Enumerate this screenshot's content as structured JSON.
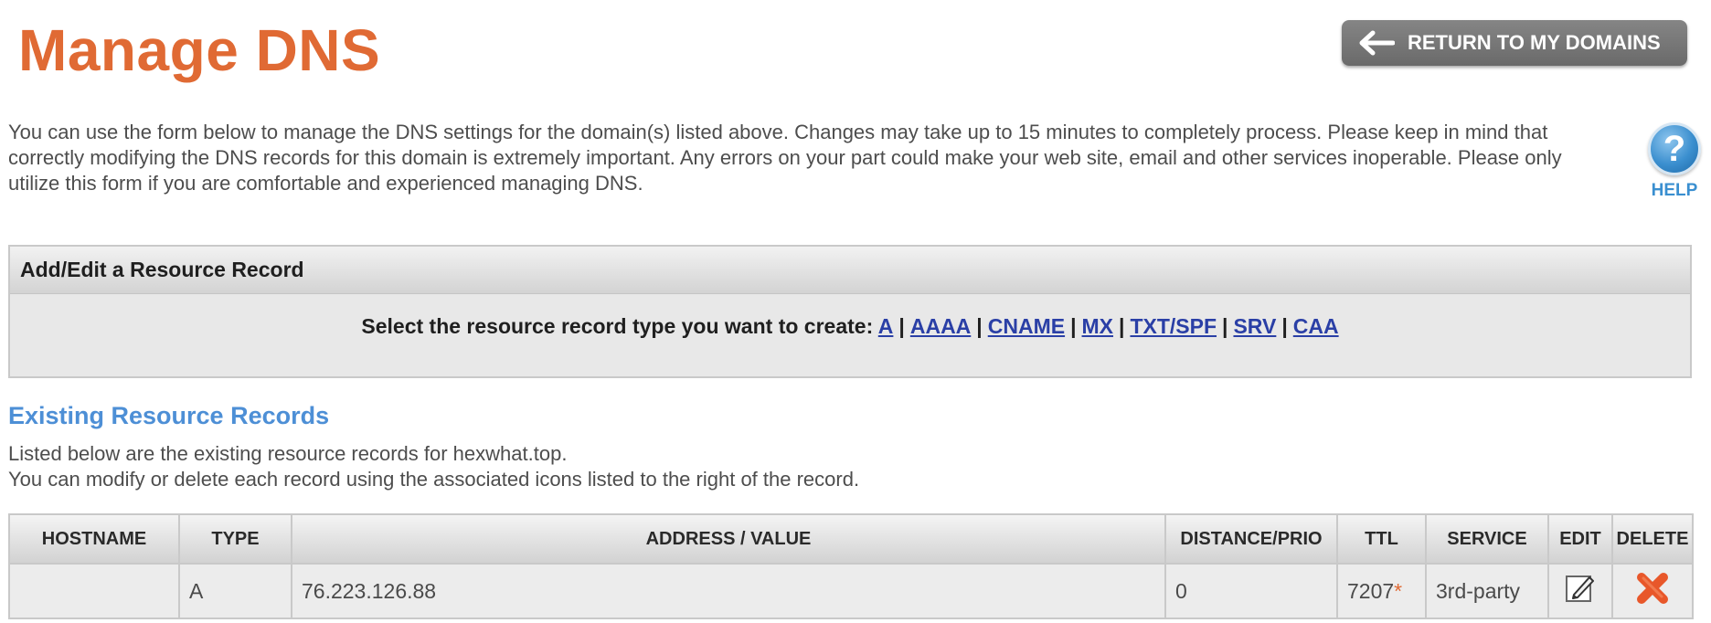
{
  "page": {
    "title": "Manage DNS",
    "return_button_label": "RETURN TO MY DOMAINS",
    "intro_text": "You can use the form below to manage the DNS settings for the domain(s) listed above. Changes may take up to 15 minutes to completely process. Please keep in mind that correctly modifying the DNS records for this domain is extremely important. Any errors on your part could make your web site, email and other services inoperable. Please only utilize this form if you are comfortable and experienced managing DNS.",
    "help_label": "HELP",
    "help_glyph": "?"
  },
  "resource_record": {
    "header": "Add/Edit a Resource Record",
    "prompt": "Select the resource record type you want to create:",
    "types": [
      "A",
      "AAAA",
      "CNAME",
      "MX",
      "TXT/SPF",
      "SRV",
      "CAA"
    ]
  },
  "existing": {
    "title": "Existing Resource Records",
    "desc_line1": "Listed below are the existing resource records for hexwhat.top.",
    "desc_line2": "You can modify or delete each record using the associated icons listed to the right of the record."
  },
  "table": {
    "columns": [
      "HOSTNAME",
      "TYPE",
      "ADDRESS / VALUE",
      "DISTANCE/PRIO",
      "TTL",
      "SERVICE",
      "EDIT",
      "DELETE"
    ],
    "rows": [
      {
        "hostname": "",
        "type": "A",
        "value": "76.223.126.88",
        "distance": "0",
        "ttl": "7207",
        "ttl_mark": "*",
        "service": "3rd-party",
        "edit_icon": "edit-icon",
        "delete_icon": "delete-icon"
      }
    ]
  },
  "colors": {
    "title": "#e06a34",
    "link": "#2a3fa6",
    "section_title": "#4d8fd6",
    "help": "#3a8fd0",
    "delete": "#e8572a"
  }
}
